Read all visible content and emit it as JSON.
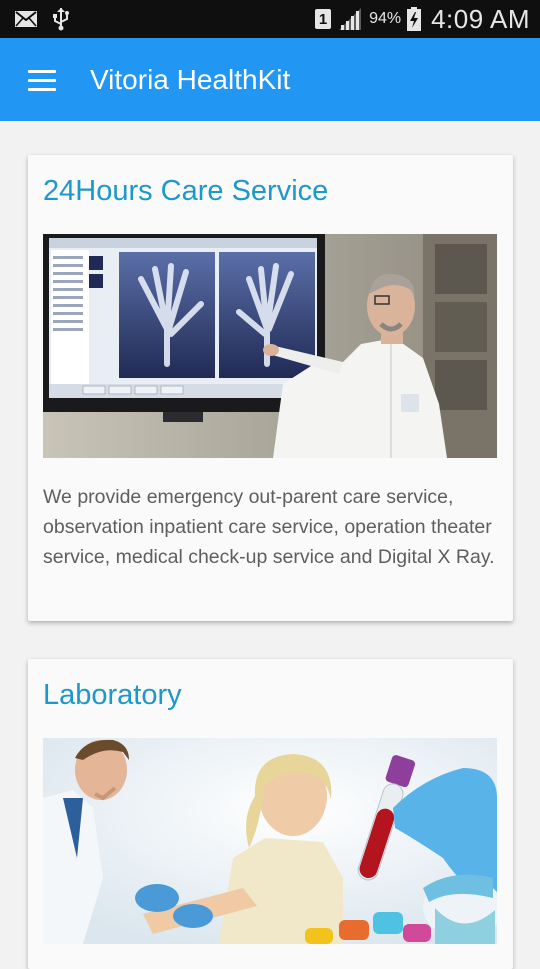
{
  "status_bar": {
    "sim_slot": "1",
    "battery_percent": "94%",
    "time": "4:09 AM",
    "icons": [
      "mail-icon",
      "usb-icon",
      "signal-icon",
      "battery-charging-icon"
    ]
  },
  "app_bar": {
    "title": "Vitoria HealthKit",
    "menu_icon": "hamburger-menu-icon",
    "color": "#2196f3"
  },
  "cards": [
    {
      "title": "24Hours Care Service",
      "image": "doctor-xray-photo",
      "text": "We provide emergency out-parent care service, observation inpatient care service, operation theater service, medical check-up service and Digital X Ray."
    },
    {
      "title": "Laboratory",
      "image": "laboratory-blood-test-photo"
    }
  ],
  "colors": {
    "card_title": "#1d98c9",
    "body_text": "#5e5e5e",
    "background": "#f2f2f2"
  }
}
